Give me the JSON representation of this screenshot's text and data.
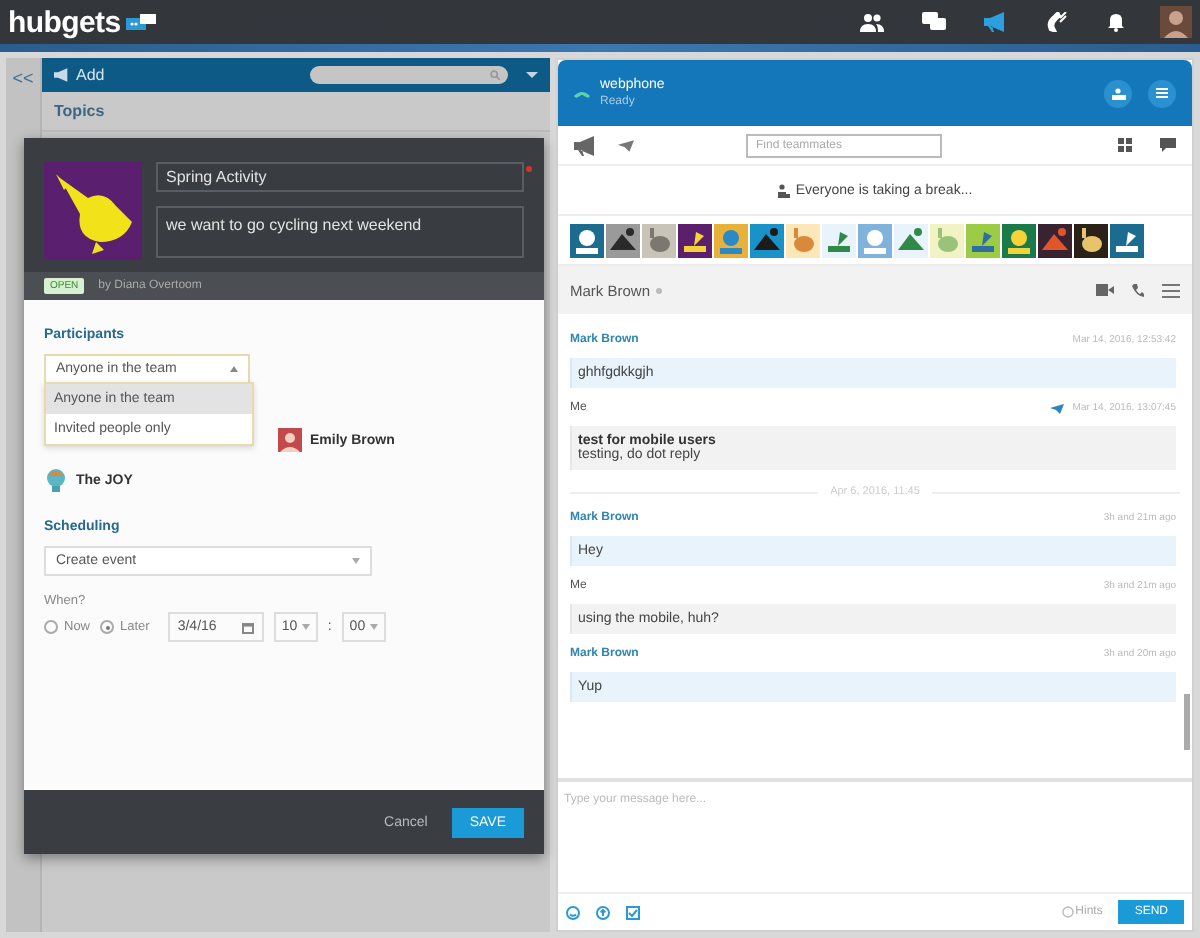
{
  "top_bar": {
    "logo": "hubgets",
    "nav_icons": [
      {
        "kind": "people",
        "selected": false
      },
      {
        "kind": "chat",
        "selected": false
      },
      {
        "kind": "megaphone",
        "selected": true
      },
      {
        "kind": "phone",
        "selected": false
      },
      {
        "kind": "bell",
        "selected": false
      }
    ]
  },
  "topics_panel": {
    "collapse": "<<",
    "add_label": "Add",
    "section_title": "Topics"
  },
  "topic_dialog": {
    "title_value": "Spring Activity",
    "description_value": "we want to go cycling next weekend",
    "status_badge": "OPEN",
    "author": "by Diana Overtoom",
    "participants_label": "Participants",
    "participants_select": {
      "value": "Anyone in the team",
      "expanded": true,
      "options": [
        {
          "label": "Anyone in the team",
          "selected": true
        },
        {
          "label": "Invited people only",
          "selected": false
        }
      ]
    },
    "participants": [
      {
        "name": "Emily Brown",
        "kind": "person"
      },
      {
        "name": "The JOY",
        "kind": "bot"
      }
    ],
    "scheduling_label": "Scheduling",
    "schedule_select": {
      "value": "Create event"
    },
    "when_label": "When?",
    "when_options": [
      {
        "label": "Now",
        "selected": false
      },
      {
        "label": "Later",
        "selected": true
      }
    ],
    "date": "3/4/16",
    "hour": "10",
    "time_separator": ":",
    "minute": "00",
    "buttons": [
      {
        "label": "Cancel",
        "kind": "link"
      },
      {
        "label": "SAVE",
        "kind": "primary"
      }
    ]
  },
  "webphone": {
    "title": "webphone",
    "status": "Ready"
  },
  "toolbar": {
    "search": {
      "placeholder": "Find teammates"
    }
  },
  "status_message": "Everyone is taking a break...",
  "conversation": {
    "contact": "Mark Brown",
    "messages": [
      {
        "kind": "message",
        "sender": "Mark Brown",
        "from_me": false,
        "time": "Mar 14, 2016, 12:53:42",
        "text": "ghhfgdkkgjh"
      },
      {
        "kind": "message",
        "sender": "Me",
        "from_me": true,
        "sent": true,
        "time": "Mar 14, 2016, 13:07:45",
        "title": "test for mobile users",
        "text": "testing, do dot reply"
      },
      {
        "kind": "divider",
        "text": "Apr 6, 2016, 11:45"
      },
      {
        "kind": "message",
        "sender": "Mark Brown",
        "from_me": false,
        "time": "3h and 21m ago",
        "text": "Hey"
      },
      {
        "kind": "message",
        "sender": "Me",
        "from_me": true,
        "time": "3h and 21m ago",
        "text": "using the mobile, huh?"
      },
      {
        "kind": "message",
        "sender": "Mark Brown",
        "from_me": false,
        "time": "3h and 20m ago",
        "text": "Yup"
      }
    ]
  },
  "composer": {
    "placeholder": "Type your message here...",
    "hints": "Hints",
    "send": "SEND"
  }
}
